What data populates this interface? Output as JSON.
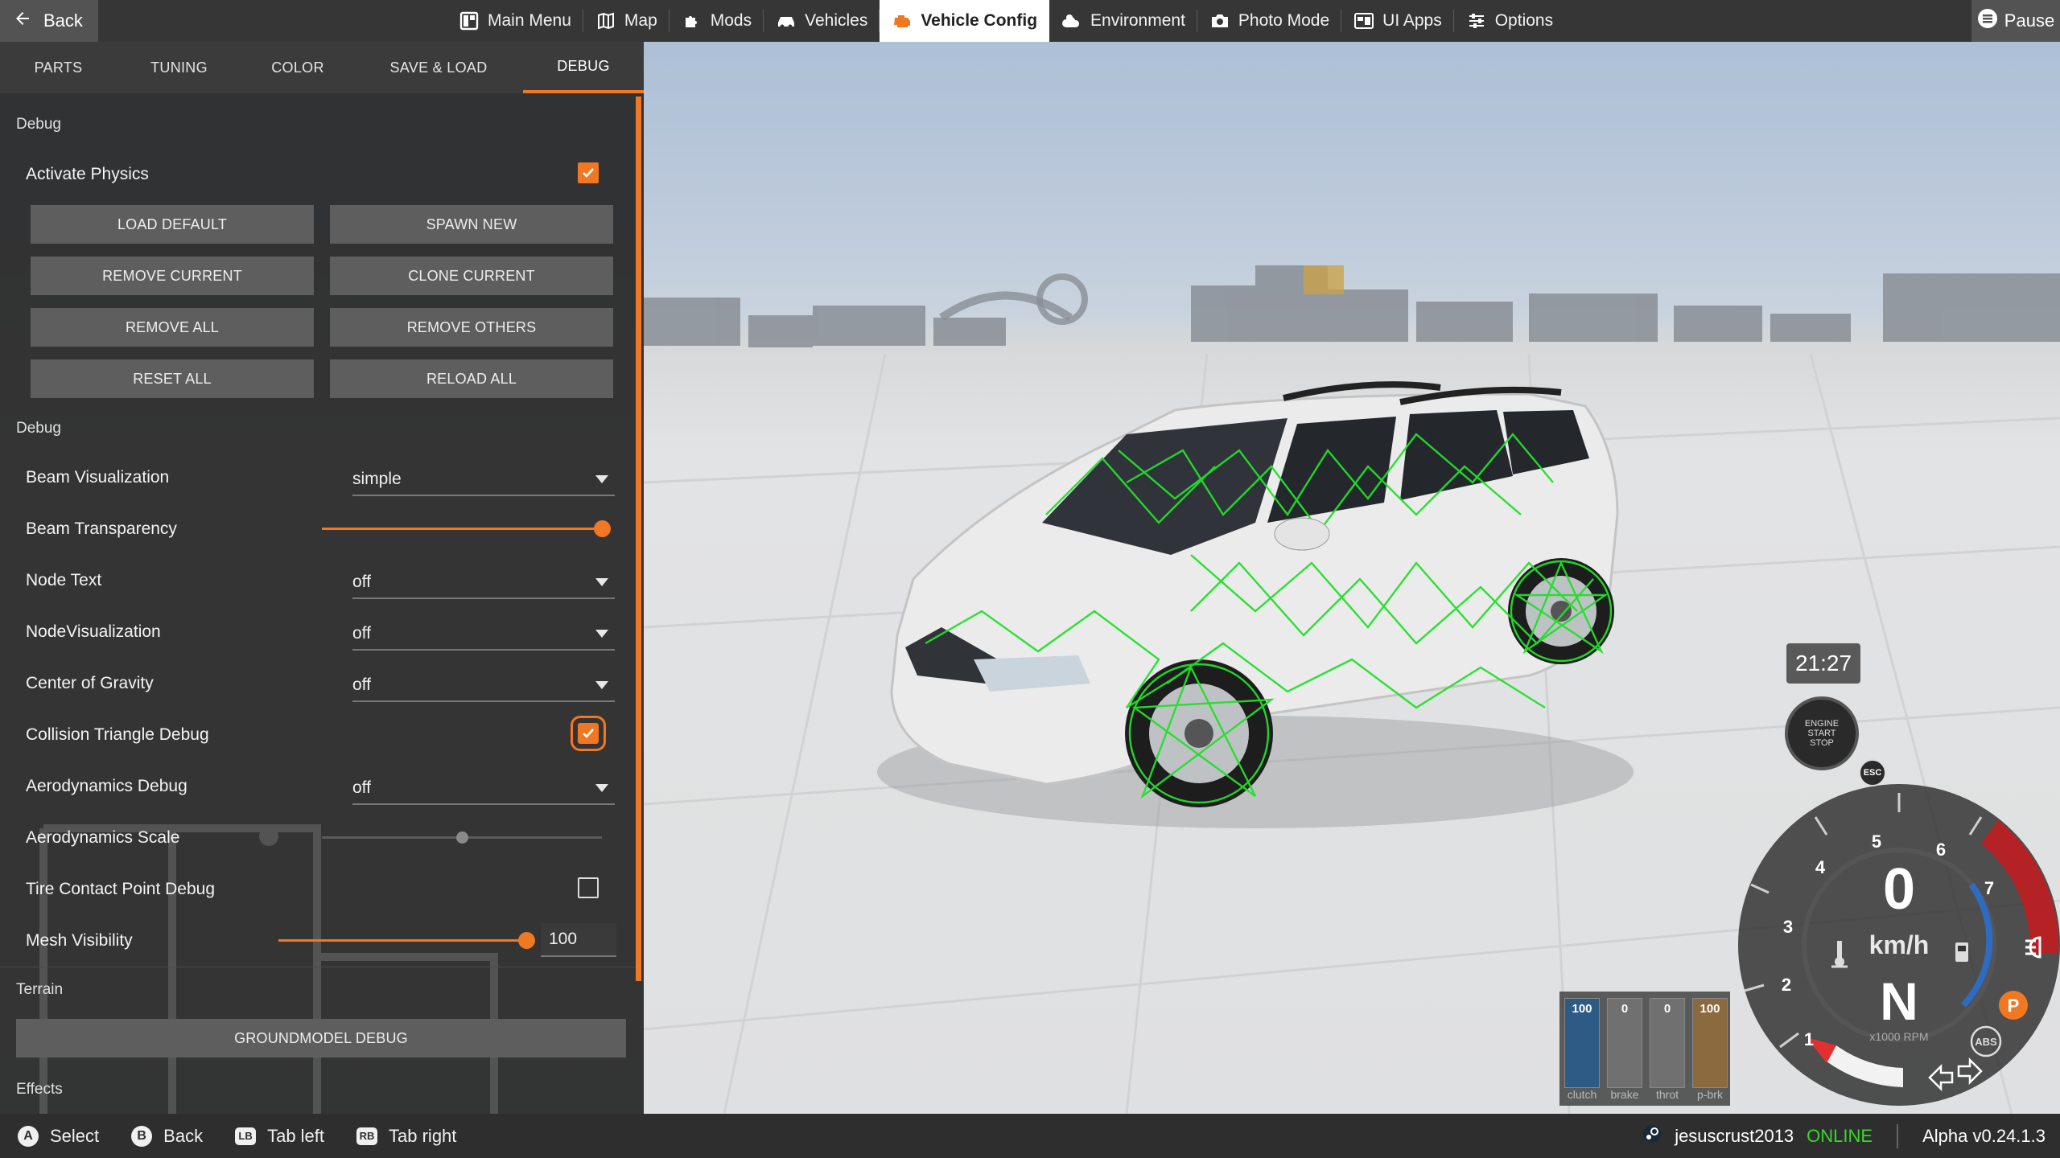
{
  "topbar": {
    "back_label": "Back",
    "nav": [
      {
        "label": "Main Menu",
        "icon": "grid-icon",
        "active": false
      },
      {
        "label": "Map",
        "icon": "map-icon",
        "active": false
      },
      {
        "label": "Mods",
        "icon": "puzzle-icon",
        "active": false
      },
      {
        "label": "Vehicles",
        "icon": "car-icon",
        "active": false
      },
      {
        "label": "Vehicle Config",
        "icon": "engine-icon",
        "active": true
      },
      {
        "label": "Environment",
        "icon": "weather-icon",
        "active": false
      },
      {
        "label": "Photo Mode",
        "icon": "camera-icon",
        "active": false
      },
      {
        "label": "UI Apps",
        "icon": "apps-icon",
        "active": false
      },
      {
        "label": "Options",
        "icon": "sliders-icon",
        "active": false
      }
    ],
    "pause_label": "Pause"
  },
  "panel": {
    "tabs": [
      "PARTS",
      "TUNING",
      "COLOR",
      "SAVE & LOAD",
      "DEBUG"
    ],
    "active_tab": "DEBUG",
    "section1_title": "Debug",
    "activate_physics": {
      "label": "Activate Physics",
      "checked": true
    },
    "buttons": {
      "load_default": "LOAD DEFAULT",
      "spawn_new": "SPAWN NEW",
      "remove_current": "REMOVE CURRENT",
      "clone_current": "CLONE CURRENT",
      "remove_all": "REMOVE ALL",
      "remove_others": "REMOVE OTHERS",
      "reset_all": "RESET ALL",
      "reload_all": "RELOAD ALL"
    },
    "section2_title": "Debug",
    "beam_visualization": {
      "label": "Beam Visualization",
      "value": "simple"
    },
    "beam_transparency": {
      "label": "Beam Transparency",
      "value": 1.0
    },
    "node_text": {
      "label": "Node Text",
      "value": "off"
    },
    "node_visualization": {
      "label": "NodeVisualization",
      "value": "off"
    },
    "center_of_gravity": {
      "label": "Center of Gravity",
      "value": "off"
    },
    "collision_triangle_debug": {
      "label": "Collision Triangle Debug",
      "checked": true
    },
    "aerodynamics_debug": {
      "label": "Aerodynamics Debug",
      "value": "off"
    },
    "aerodynamics_scale": {
      "label": "Aerodynamics Scale",
      "value": 0.5
    },
    "tire_contact_point_debug": {
      "label": "Tire Contact Point Debug",
      "checked": false
    },
    "mesh_visibility": {
      "label": "Mesh Visibility",
      "value": "100",
      "fraction": 1.0
    },
    "terrain_title": "Terrain",
    "groundmodel_debug": "GROUNDMODEL DEBUG",
    "effects_title": "Effects"
  },
  "bottombar": {
    "hints": [
      {
        "button": "A",
        "label": "Select"
      },
      {
        "button": "B",
        "label": "Back"
      },
      {
        "button": "LB",
        "label": "Tab left"
      },
      {
        "button": "RB",
        "label": "Tab right"
      }
    ],
    "username": "jesuscrust2013",
    "status": "ONLINE",
    "version": "Alpha v0.24.1.3"
  },
  "hud": {
    "clock": "21:27",
    "engine_button": [
      "ENGINE",
      "START",
      "STOP"
    ],
    "speed": "0",
    "speed_unit": "km/h",
    "gear": "N",
    "rpm_label": "x1000 RPM",
    "rpm_ticks": [
      "1",
      "2",
      "3",
      "4",
      "5",
      "6",
      "7"
    ],
    "esc_label": "ESC",
    "abs_label": "ABS",
    "parking_label": "P",
    "pedals": [
      {
        "label": "clutch",
        "value": "100",
        "fraction": 1.0,
        "color": "#2e5b86"
      },
      {
        "label": "brake",
        "value": "0",
        "fraction": 0.0,
        "color": "#7a7a7a"
      },
      {
        "label": "throt",
        "value": "0",
        "fraction": 0.0,
        "color": "#7a7a7a"
      },
      {
        "label": "p-brk",
        "value": "100",
        "fraction": 1.0,
        "color": "#8a6a3e"
      }
    ]
  },
  "colors": {
    "accent": "#f07822",
    "online": "#39d82b",
    "wireframe": "#22e02a"
  }
}
